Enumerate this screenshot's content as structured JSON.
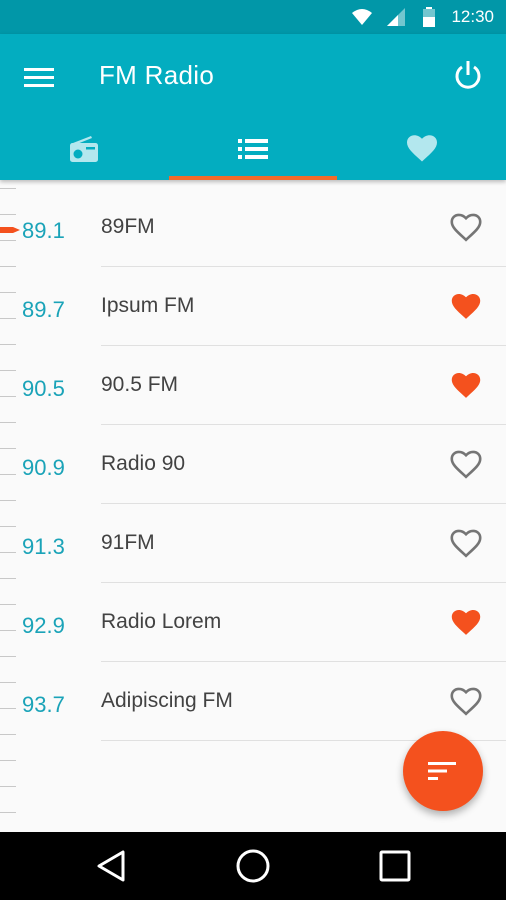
{
  "status_bar": {
    "time": "12:30",
    "icons": [
      "wifi-icon",
      "cell-signal-icon",
      "battery-icon"
    ]
  },
  "app_bar": {
    "title": "FM Radio",
    "menu_icon": "menu-icon",
    "power_icon": "power-icon"
  },
  "tabs": [
    {
      "icon": "radio-icon",
      "active": false
    },
    {
      "icon": "list-icon",
      "active": true
    },
    {
      "icon": "heart-icon",
      "active": false
    }
  ],
  "stations": [
    {
      "freq": "89.1",
      "name": "89FM",
      "favorite": false
    },
    {
      "freq": "89.7",
      "name": "Ipsum FM",
      "favorite": true
    },
    {
      "freq": "90.5",
      "name": "90.5 FM",
      "favorite": true
    },
    {
      "freq": "90.9",
      "name": "Radio 90",
      "favorite": false
    },
    {
      "freq": "91.3",
      "name": "91FM",
      "favorite": false
    },
    {
      "freq": "92.9",
      "name": "Radio Lorem",
      "favorite": true
    },
    {
      "freq": "93.7",
      "name": "Adipiscing FM",
      "favorite": false
    }
  ],
  "fab": {
    "icon": "sort-icon"
  },
  "nav_bar": {
    "icons": [
      "back-icon",
      "home-icon",
      "recents-icon"
    ]
  },
  "colors": {
    "primary": "#03adc0",
    "primary_dark": "#0197a8",
    "accent": "#f4511e",
    "frequency_text": "#1aa3b8",
    "favorite": "#f4511e",
    "unfavorite": "#757575"
  }
}
